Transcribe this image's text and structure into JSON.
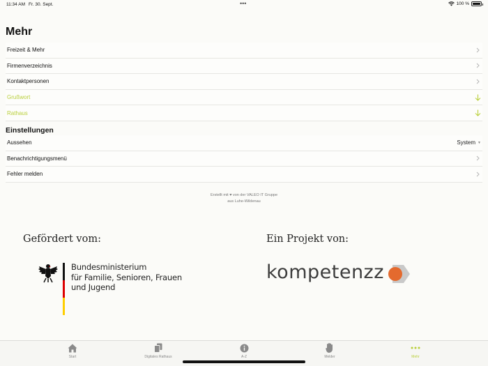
{
  "status": {
    "time": "11:34 AM",
    "date": "Fr. 30. Sept.",
    "battery": "100 %",
    "battery_level": 1.0
  },
  "page": {
    "title": "Mehr"
  },
  "menu": [
    {
      "label": "Freizeit & Mehr",
      "icon": "chevron-right-icon",
      "highlight": false
    },
    {
      "label": "Firmenverzeichnis",
      "icon": "chevron-right-icon",
      "highlight": false
    },
    {
      "label": "Kontaktpersonen",
      "icon": "chevron-right-icon",
      "highlight": false
    },
    {
      "label": "Grußwort",
      "icon": "arrow-down-icon",
      "highlight": true
    },
    {
      "label": "Rathaus",
      "icon": "arrow-down-icon",
      "highlight": true
    }
  ],
  "settings": {
    "title": "Einstellungen",
    "appearance": {
      "label": "Aussehen",
      "value": "System"
    },
    "notifications": {
      "label": "Benachrichtigungsmenü"
    },
    "report": {
      "label": "Fehler melden"
    }
  },
  "credit": {
    "line1_prefix": "Erstellt mit",
    "line1_suffix": "von der VALEO IT Gruppe",
    "line2": "aus Luhe-Wildenau"
  },
  "sponsors": {
    "funded_label": "Gefördert vom:",
    "ministry_lines": [
      "Bundesministerium",
      "für Familie, Senioren, Frauen",
      "und Jugend"
    ],
    "project_label": "Ein Projekt von:",
    "project_logo_text": "kompetenzz"
  },
  "tabs": [
    {
      "label": "Start",
      "icon": "house-icon",
      "active": false
    },
    {
      "label": "Digitales Rathaus",
      "icon": "documents-icon",
      "active": false
    },
    {
      "label": "A-Z",
      "icon": "info-icon",
      "active": false
    },
    {
      "label": "Melder",
      "icon": "hand-icon",
      "active": false
    },
    {
      "label": "Mehr",
      "icon": "more-dots-icon",
      "active": true
    }
  ],
  "colors": {
    "accent": "#b9cf3a",
    "logo_orange": "#e46a2e",
    "flag_black": "#111111",
    "flag_red": "#dd0000",
    "flag_gold": "#ffce00"
  }
}
